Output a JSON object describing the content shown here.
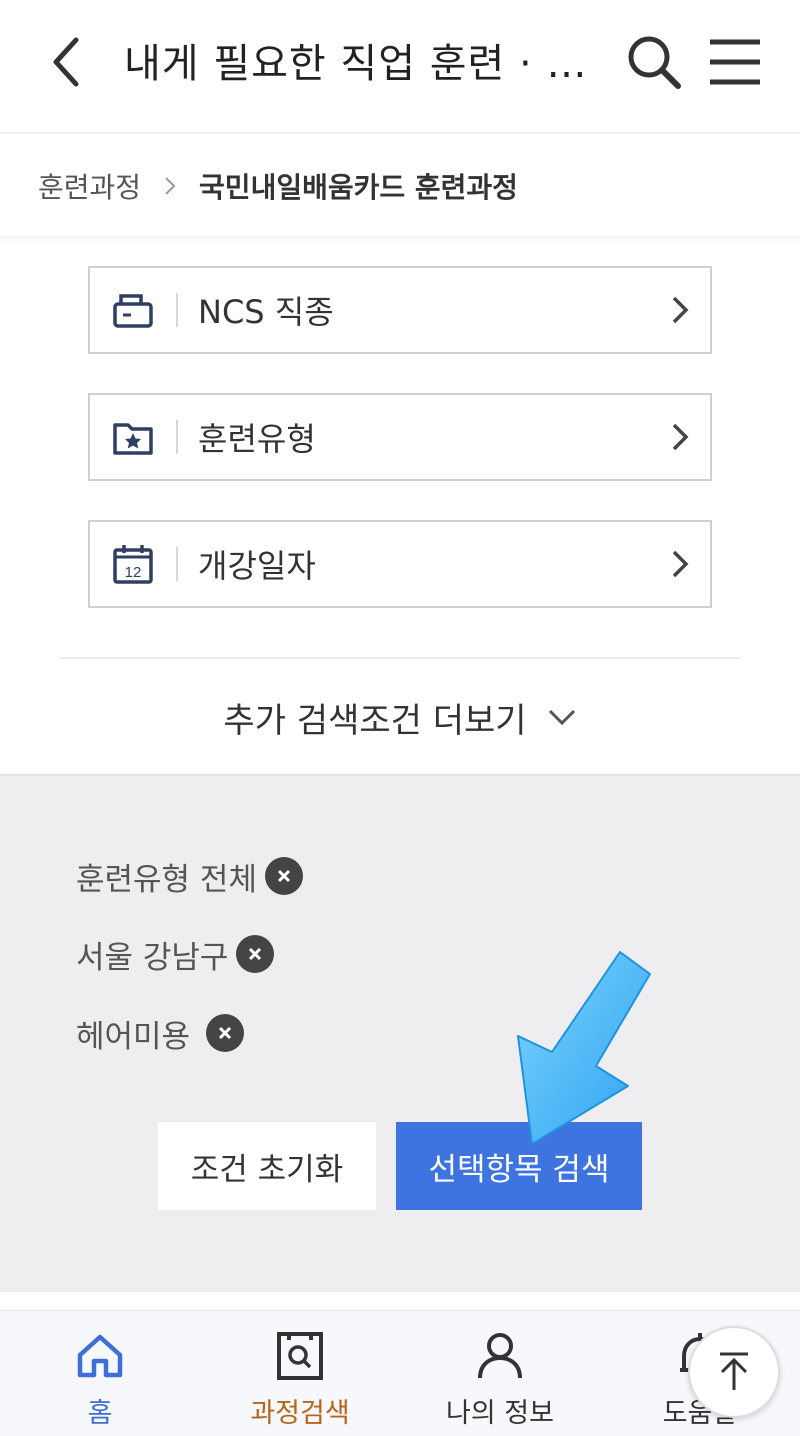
{
  "header": {
    "title": "내게 필요한 직업 훈련 · …",
    "back_icon": "chevron-left-icon",
    "search_icon": "search-icon",
    "menu_icon": "hamburger-menu-icon"
  },
  "breadcrumb": {
    "items": [
      "훈련과정",
      "국민내일배움카드 훈련과정"
    ]
  },
  "filters": [
    {
      "label": "NCS 직종",
      "icon": "briefcase-icon"
    },
    {
      "label": "훈련유형",
      "icon": "folder-star-icon"
    },
    {
      "label": "개강일자",
      "icon": "calendar-icon",
      "icon_text": "12"
    }
  ],
  "more_conditions": {
    "label": "추가 검색조건 더보기"
  },
  "selected_tags": [
    "훈련유형 전체",
    "서울 강남구",
    "헤어미용"
  ],
  "actions": {
    "reset_label": "조건 초기화",
    "search_label": "선택항목 검색"
  },
  "bottom_nav": {
    "items": [
      {
        "label": "홈",
        "icon": "home-icon"
      },
      {
        "label": "과정검색",
        "icon": "course-search-icon"
      },
      {
        "label": "나의 정보",
        "icon": "user-icon"
      },
      {
        "label": "도움말",
        "icon": "help-icon"
      }
    ]
  },
  "colors": {
    "primary": "#3e74e0",
    "home_active": "#3d6fd6",
    "search_label": "#b8651a",
    "panel_bg": "#eeeef1",
    "arrow": "#3db2f5"
  }
}
